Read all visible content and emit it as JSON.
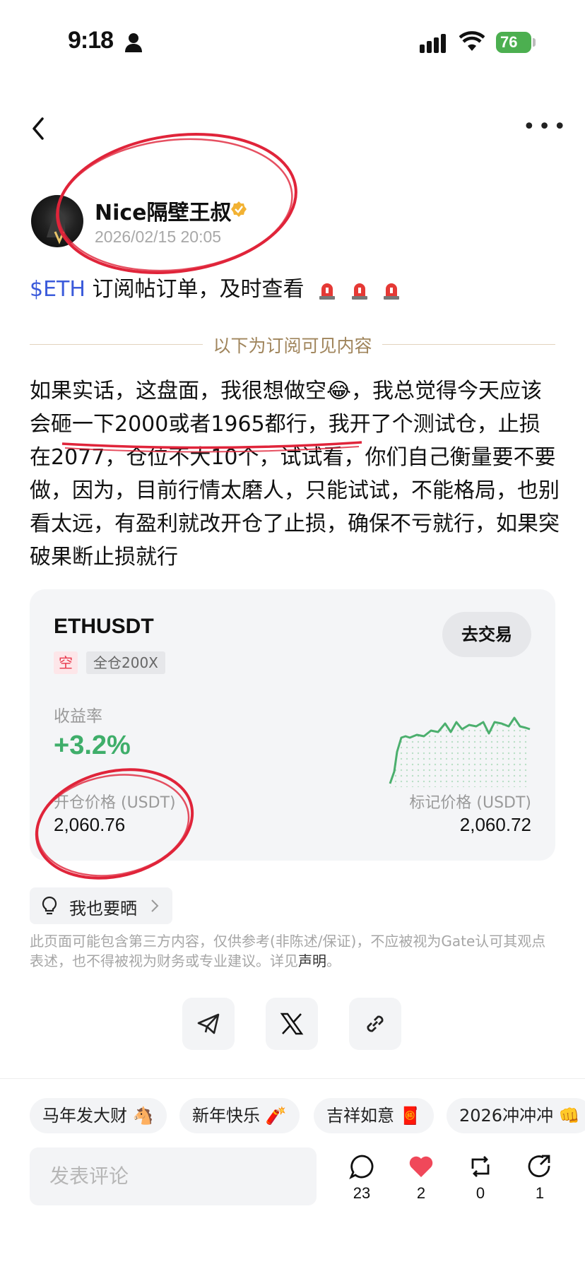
{
  "status_bar": {
    "time": "9:18",
    "battery": "76"
  },
  "author": {
    "name": "Nice隔壁王叔",
    "timestamp": "2026/02/15 20:05"
  },
  "post": {
    "ticker": "$ETH",
    "title": "订阅帖订单，及时查看",
    "divider": "以下为订阅可见内容",
    "body": "如果实话，这盘面，我很想做空😂，我总觉得今天应该会砸一下2000或者1965都行，我开了个测试仓，止损在2077，仓位不大10个，试试看，你们自己衡量要不要做，因为，目前行情太磨人，只能试试，不能格局，也别看太远，有盈利就改开仓了止损，确保不亏就行，如果突破果断止损就行"
  },
  "trade_card": {
    "pair": "ETHUSDT",
    "trade_button": "去交易",
    "direction": "空",
    "margin_mode": "全仓200X",
    "yield_label": "收益率",
    "yield_value": "+3.2%",
    "open_price_label": "开仓价格 (USDT)",
    "open_price": "2,060.76",
    "mark_price_label": "标记价格 (USDT)",
    "mark_price": "2,060.72",
    "colors": {
      "up": "#3fae6a",
      "short": "#e8374b"
    }
  },
  "share_pill": {
    "label": "我也要晒"
  },
  "disclaimer": {
    "text": "此页面可能包含第三方内容，仅供参考(非陈述/保证)，不应被视为Gate认可其观点表述，也不得被视为财务或专业建议。详见",
    "link": "声明",
    "end": "。"
  },
  "share_buttons": [
    "telegram-icon",
    "x-icon",
    "link-icon"
  ],
  "quick_tags": [
    "马年发大财 🐴",
    "新年快乐 🧨",
    "吉祥如意 🧧",
    "2026冲冲冲 👊"
  ],
  "comment": {
    "placeholder": "发表评论",
    "actions": [
      {
        "icon": "comment-icon",
        "count": "23"
      },
      {
        "icon": "heart-icon",
        "count": "2"
      },
      {
        "icon": "repost-icon",
        "count": "0"
      },
      {
        "icon": "share-icon",
        "count": "1"
      }
    ]
  }
}
